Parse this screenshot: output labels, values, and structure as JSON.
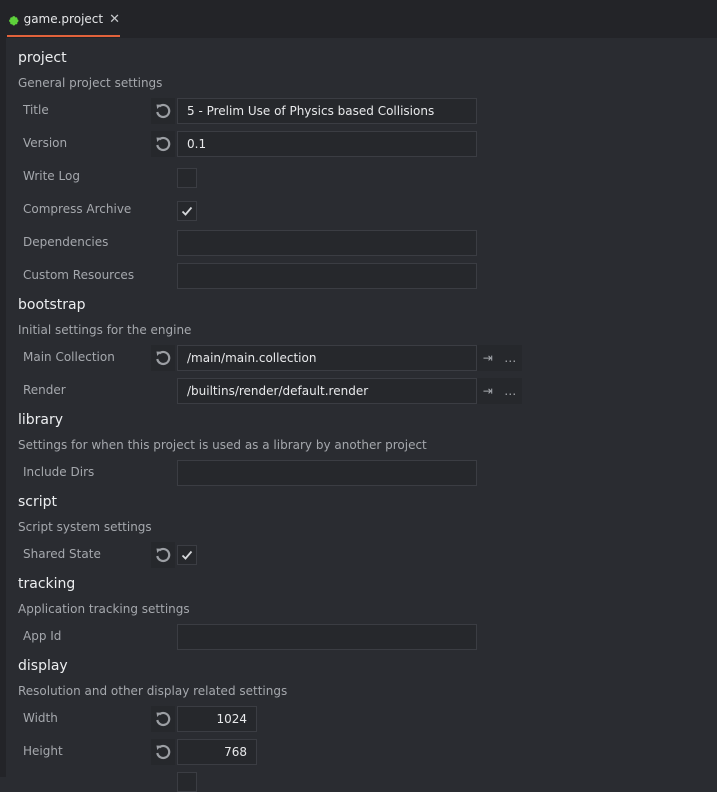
{
  "tab": {
    "label": "game.project",
    "icon": "defold-gear-icon",
    "close_glyph": "✕",
    "accent_color": "#e2623b"
  },
  "sections": {
    "project": {
      "title": "project",
      "description": "General project settings",
      "title_label": "Title",
      "title_value": "5 - Prelim Use of Physics based Collisions",
      "version_label": "Version",
      "version_value": "0.1",
      "write_log_label": "Write Log",
      "write_log_checked": false,
      "compress_archive_label": "Compress Archive",
      "compress_archive_checked": true,
      "dependencies_label": "Dependencies",
      "dependencies_value": "",
      "custom_resources_label": "Custom Resources",
      "custom_resources_value": ""
    },
    "bootstrap": {
      "title": "bootstrap",
      "description": "Initial settings for the engine",
      "main_collection_label": "Main Collection",
      "main_collection_value": "/main/main.collection",
      "render_label": "Render",
      "render_value": "/builtins/render/default.render",
      "goto_glyph": "⇥",
      "browse_glyph": "…"
    },
    "library": {
      "title": "library",
      "description": "Settings for when this project is used as a library by another project",
      "include_dirs_label": "Include Dirs",
      "include_dirs_value": ""
    },
    "script": {
      "title": "script",
      "description": "Script system settings",
      "shared_state_label": "Shared State",
      "shared_state_checked": true
    },
    "tracking": {
      "title": "tracking",
      "description": "Application tracking settings",
      "app_id_label": "App Id",
      "app_id_value": ""
    },
    "display": {
      "title": "display",
      "description": "Resolution and other display related settings",
      "width_label": "Width",
      "width_value": "1024",
      "height_label": "Height",
      "height_value": "768"
    }
  }
}
